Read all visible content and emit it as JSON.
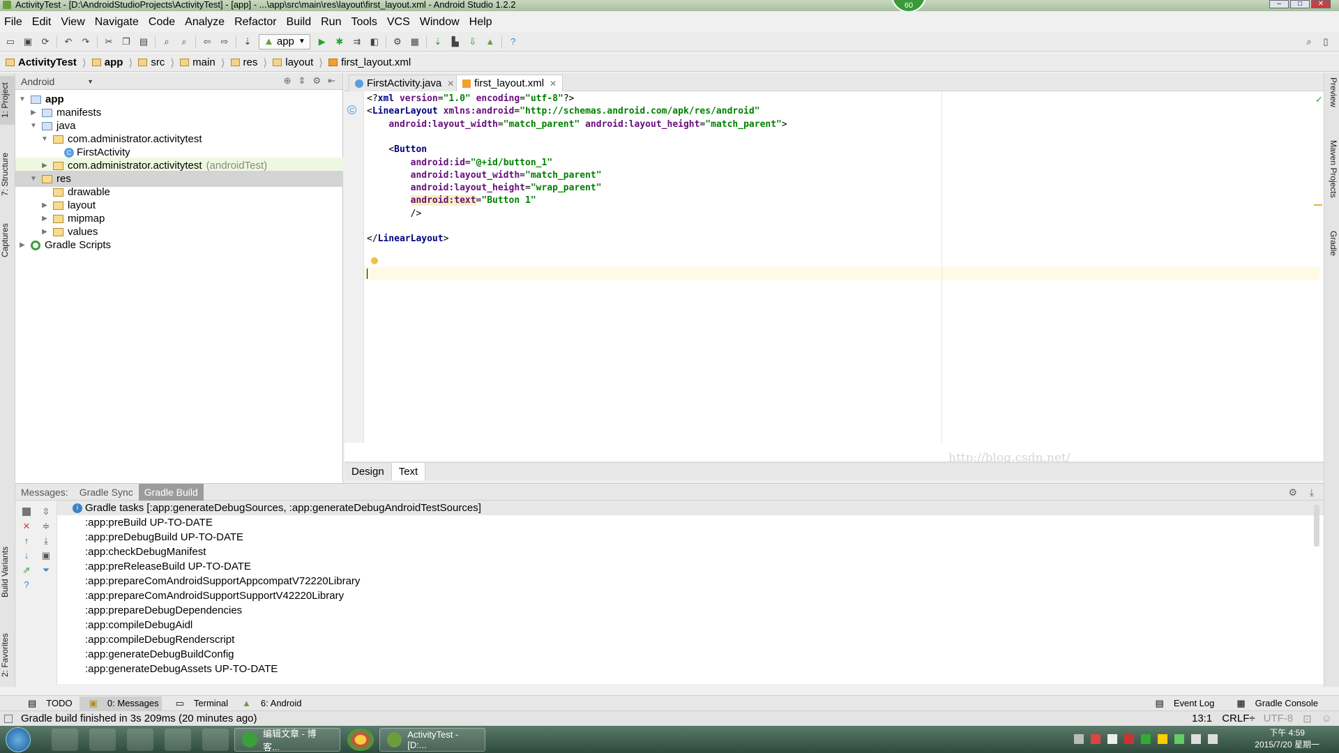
{
  "window": {
    "title": "ActivityTest - [D:\\AndroidStudioProjects\\ActivityTest] - [app] - ...\\app\\src\\main\\res\\layout\\first_layout.xml - Android Studio 1.2.2",
    "badge": "60"
  },
  "menu": [
    "File",
    "Edit",
    "View",
    "Navigate",
    "Code",
    "Analyze",
    "Refactor",
    "Build",
    "Run",
    "Tools",
    "VCS",
    "Window",
    "Help"
  ],
  "toolbar": {
    "run_config": "app"
  },
  "breadcrumbs": [
    "ActivityTest",
    "app",
    "src",
    "main",
    "res",
    "layout",
    "first_layout.xml"
  ],
  "left_tabs": [
    "1: Project",
    "7: Structure",
    "Captures",
    "Build Variants",
    "2: Favorites"
  ],
  "right_tabs": [
    "Preview",
    "Maven Projects",
    "Gradle"
  ],
  "project": {
    "view_selector": "Android",
    "tree": [
      {
        "label": "app",
        "indent": 0,
        "arrow": "▼",
        "icon": "folder-blue",
        "bold": true
      },
      {
        "label": "manifests",
        "indent": 1,
        "arrow": "▶",
        "icon": "folder-blue"
      },
      {
        "label": "java",
        "indent": 1,
        "arrow": "▼",
        "icon": "folder-blue"
      },
      {
        "label": "com.administrator.activitytest",
        "indent": 2,
        "arrow": "▼",
        "icon": "folder"
      },
      {
        "label": "FirstActivity",
        "indent": 3,
        "arrow": "",
        "icon": "class"
      },
      {
        "label": "com.administrator.activitytest",
        "suffix": "(androidTest)",
        "indent": 2,
        "arrow": "▶",
        "icon": "folder",
        "highlight": true
      },
      {
        "label": "res",
        "indent": 1,
        "arrow": "▼",
        "icon": "folder",
        "selected": true
      },
      {
        "label": "drawable",
        "indent": 2,
        "arrow": "",
        "icon": "folder"
      },
      {
        "label": "layout",
        "indent": 2,
        "arrow": "▶",
        "icon": "folder"
      },
      {
        "label": "mipmap",
        "indent": 2,
        "arrow": "▶",
        "icon": "folder"
      },
      {
        "label": "values",
        "indent": 2,
        "arrow": "▶",
        "icon": "folder"
      },
      {
        "label": "Gradle Scripts",
        "indent": 0,
        "arrow": "▶",
        "icon": "gradle"
      }
    ]
  },
  "editor": {
    "tabs": [
      {
        "label": "FirstActivity.java",
        "active": false
      },
      {
        "label": "first_layout.xml",
        "active": true
      }
    ],
    "code": [
      [
        [
          "pun",
          "<?"
        ],
        [
          "tag",
          "xml "
        ],
        [
          "att",
          "version"
        ],
        [
          "pun",
          "="
        ],
        [
          "val",
          "\"1.0\""
        ],
        [
          "pun",
          " "
        ],
        [
          "att",
          "encoding"
        ],
        [
          "pun",
          "="
        ],
        [
          "val",
          "\"utf-8\""
        ],
        [
          "pun",
          "?>"
        ]
      ],
      [
        [
          "pun",
          "<"
        ],
        [
          "tag",
          "LinearLayout "
        ],
        [
          "att",
          "xmlns:android"
        ],
        [
          "pun",
          "="
        ],
        [
          "val",
          "\"http://schemas.android.com/apk/res/android\""
        ]
      ],
      [
        [
          "pun",
          "    "
        ],
        [
          "att",
          "android:layout_width"
        ],
        [
          "pun",
          "="
        ],
        [
          "val",
          "\"match_parent\""
        ],
        [
          "pun",
          " "
        ],
        [
          "att",
          "android:layout_height"
        ],
        [
          "pun",
          "="
        ],
        [
          "val",
          "\"match_parent\""
        ],
        [
          "pun",
          ">"
        ]
      ],
      [],
      [
        [
          "pun",
          "    <"
        ],
        [
          "tag",
          "Button"
        ]
      ],
      [
        [
          "pun",
          "        "
        ],
        [
          "att",
          "android:id"
        ],
        [
          "pun",
          "="
        ],
        [
          "val",
          "\"@+id/button_1\""
        ]
      ],
      [
        [
          "pun",
          "        "
        ],
        [
          "att",
          "android:layout_width"
        ],
        [
          "pun",
          "="
        ],
        [
          "val",
          "\"match_parent\""
        ]
      ],
      [
        [
          "pun",
          "        "
        ],
        [
          "att",
          "android:layout_height"
        ],
        [
          "pun",
          "="
        ],
        [
          "val",
          "\"wrap_parent\""
        ]
      ],
      [
        [
          "pun",
          "        "
        ],
        [
          "att",
          "android:text"
        ],
        [
          "pun",
          "="
        ],
        [
          "val",
          "\"Button 1\""
        ]
      ],
      [
        [
          "pun",
          "        />"
        ]
      ],
      [],
      [
        [
          "pun",
          "</"
        ],
        [
          "tag",
          "LinearLayout"
        ],
        [
          "pun",
          ">"
        ]
      ],
      []
    ],
    "watermark": "http://blog.csdn.net/",
    "mode_tabs": [
      {
        "label": "Design",
        "active": false
      },
      {
        "label": "Text",
        "active": true
      }
    ]
  },
  "bottom": {
    "tabs": [
      {
        "label": "Messages:",
        "on": false
      },
      {
        "label": "Gradle Sync",
        "on": false
      },
      {
        "label": "Gradle Build",
        "on": true
      }
    ],
    "header": "Gradle tasks [:app:generateDebugSources, :app:generateDebugAndroidTestSources]",
    "lines": [
      ":app:preBuild UP-TO-DATE",
      ":app:preDebugBuild UP-TO-DATE",
      ":app:checkDebugManifest",
      ":app:preReleaseBuild UP-TO-DATE",
      ":app:prepareComAndroidSupportAppcompatV72220Library",
      ":app:prepareComAndroidSupportSupportV42220Library",
      ":app:prepareDebugDependencies",
      ":app:compileDebugAidl",
      ":app:compileDebugRenderscript",
      ":app:generateDebugBuildConfig",
      ":app:generateDebugAssets UP-TO-DATE"
    ]
  },
  "toolwindows": {
    "left": [
      "TODO",
      "0: Messages",
      "Terminal",
      "6: Android"
    ],
    "right": [
      "Event Log",
      "Gradle Console"
    ]
  },
  "status": {
    "message": "Gradle build finished in 3s 209ms (20 minutes ago)",
    "position": "13:1",
    "line_sep": "CRLF÷",
    "encoding": "UTF-8"
  },
  "taskbar": {
    "tasks": [
      "编辑文章 - 博客...",
      "ActivityTest - [D:..."
    ],
    "time": "下午 4:59",
    "date": "2015/7/20 星期一"
  }
}
